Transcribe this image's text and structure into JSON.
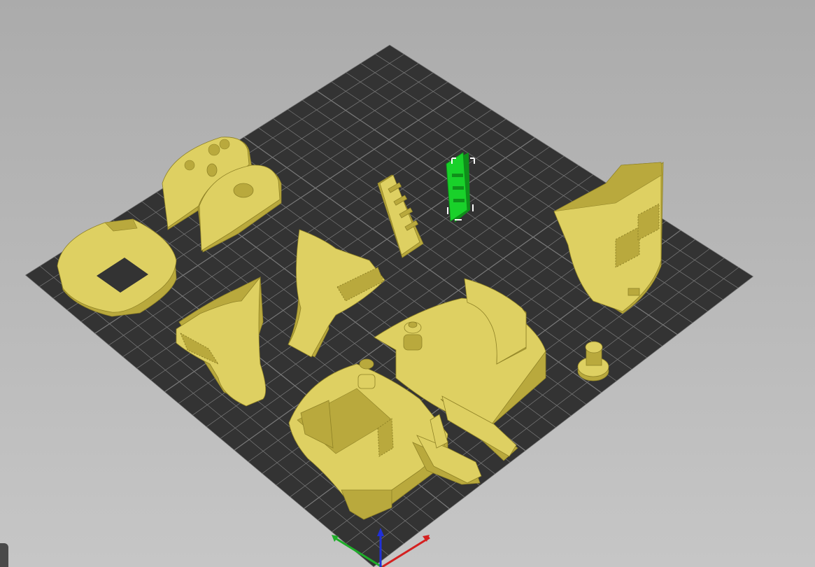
{
  "colors": {
    "background_top": "#ababab",
    "background_bottom": "#c6c6c6",
    "bed": "#333333",
    "grid": "#7a7a7a",
    "part": "#ded062",
    "part_shade": "#b9a93d",
    "part_dark": "#8f8226",
    "selected": "#19d12a",
    "selected_dark": "#0f8f1a",
    "axis_x": "#d42020",
    "axis_y": "#1fae2a",
    "axis_z": "#2030d8"
  },
  "scene": {
    "view": "3D perspective",
    "objects": [
      {
        "id": "oval-mount",
        "selected": false
      },
      {
        "id": "rounded-cover-pair",
        "selected": false
      },
      {
        "id": "stair-step",
        "selected": false
      },
      {
        "id": "stair-step-selected",
        "selected": true
      },
      {
        "id": "tall-housing",
        "selected": false
      },
      {
        "id": "curved-fin-left",
        "selected": false
      },
      {
        "id": "curved-fin-right",
        "selected": false
      },
      {
        "id": "cab-body-large",
        "selected": false
      },
      {
        "id": "small-knob",
        "selected": false
      },
      {
        "id": "cab-body-front",
        "selected": false
      }
    ]
  },
  "axes": {
    "x": "x-axis",
    "y": "y-axis",
    "z": "z-axis"
  }
}
